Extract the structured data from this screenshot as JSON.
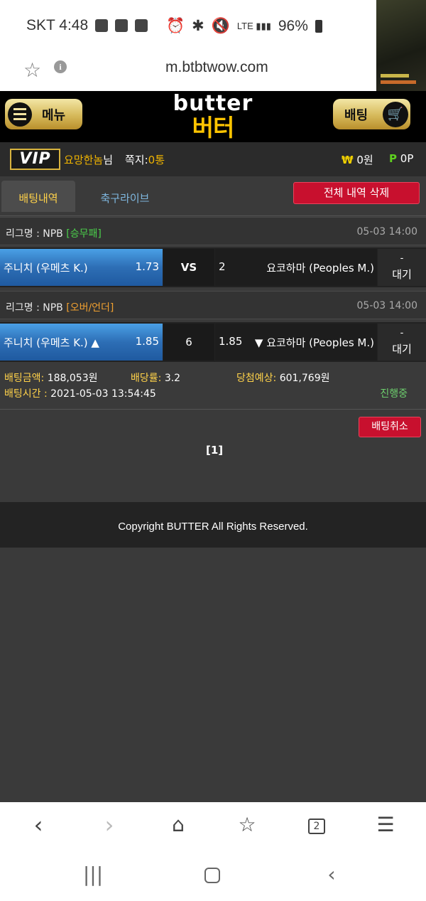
{
  "status_bar": {
    "carrier_time": "SKT 4:48",
    "battery": "96%"
  },
  "browser": {
    "url": "m.btbtwow.com"
  },
  "header": {
    "menu_label": "메뉴",
    "bet_label": "배팅",
    "logo_en": "butter",
    "logo_ko": "버터"
  },
  "user": {
    "vip_label": "VIP",
    "name": "요망한놈",
    "name_suffix": "님",
    "messages_label": "쪽지:",
    "messages_count": "0통",
    "money_symbol": "₩",
    "money": "0원",
    "points_symbol": "P",
    "points": "0P"
  },
  "tabs": [
    {
      "label": "배팅내역"
    },
    {
      "label": "축구라이브"
    }
  ],
  "delete_all_label": "전체 내역 삭제",
  "bets": [
    {
      "league_label": "리그명 : NPB",
      "market": "[승무패]",
      "date": "05-03 14:00",
      "home": "주니치 (우메츠 K.)",
      "home_odds": "1.73",
      "middle": "VS",
      "away_odds": "2",
      "away": "요코하마 (Peoples M.)",
      "status_dash": "-",
      "status": "대기"
    },
    {
      "league_label": "리그명 : NPB",
      "market": "[오버/언더]",
      "date": "05-03 14:00",
      "home": "주니치 (우메츠 K.) ▲",
      "home_odds": "1.85",
      "middle": "6",
      "away_odds": "1.85",
      "away": "▼ 요코하마 (Peoples M.)",
      "status_dash": "-",
      "status": "대기"
    }
  ],
  "summary": {
    "amount_label": "배팅금액:",
    "amount": "188,053원",
    "rate_label": "배당률:",
    "rate": "3.2",
    "expected_label": "당첨예상:",
    "expected": "601,769원",
    "time_label": "배팅시간 :",
    "time": "2021-05-03 13:54:45",
    "progress": "진행중"
  },
  "cancel_label": "배팅취소",
  "pager": "[1]",
  "footer": "Copyright BUTTER All Rights Reserved.",
  "colors": {
    "accent_red": "#c8102e",
    "gold": "#f0b400",
    "blue": "#2d6eb5",
    "green": "#4bd04b"
  },
  "icons": [
    "star-icon",
    "info-icon",
    "menu-icon",
    "cart-icon",
    "back-icon",
    "forward-icon",
    "home-icon",
    "bookmarks-icon",
    "tabs-icon",
    "more-icon"
  ]
}
